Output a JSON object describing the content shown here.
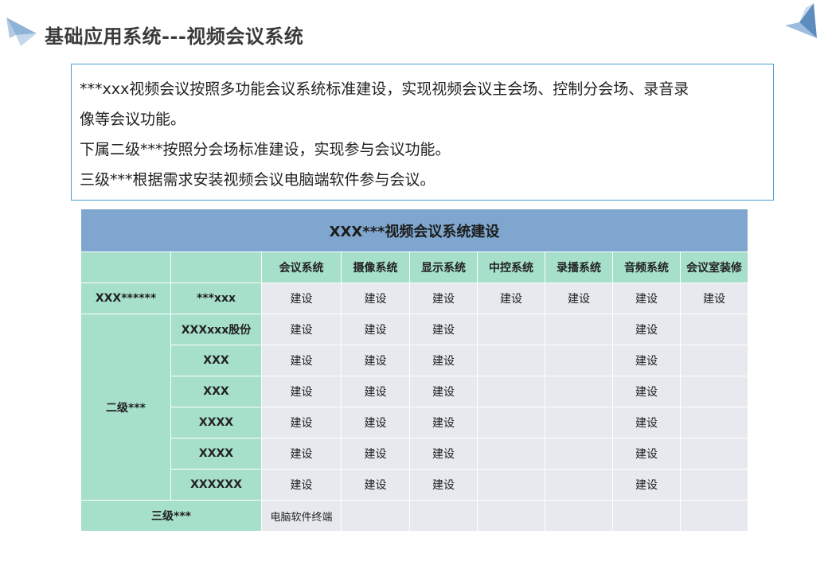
{
  "title": "基础应用系统---视频会议系统",
  "description": [
    "***xxx视频会议按照多功能会议系统标准建设，实现视频会议主会场、控制分会场、录音录",
    "像等会议功能。",
    "下属二级***按照分会场标准建设，实现参与会议功能。",
    "三级***根据需求安装视频会议电脑端软件参与会议。"
  ],
  "table": {
    "title": "XXX***视频会议系统建设",
    "columns": [
      "会议系统",
      "摄像系统",
      "显示系统",
      "中控系统",
      "录播系统",
      "音频系统",
      "会议室装修"
    ],
    "level1": {
      "label": "XXX******",
      "sublabel": "***xxx",
      "cells": [
        "建设",
        "建设",
        "建设",
        "建设",
        "建设",
        "建设",
        "建设"
      ]
    },
    "level2": {
      "label": "二级***",
      "rows": [
        {
          "name": "XXXxxx股份",
          "cells": [
            "建设",
            "建设",
            "建设",
            "",
            "",
            "建设",
            ""
          ]
        },
        {
          "name": "XXX",
          "cells": [
            "建设",
            "建设",
            "建设",
            "",
            "",
            "建设",
            ""
          ]
        },
        {
          "name": "XXX",
          "cells": [
            "建设",
            "建设",
            "建设",
            "",
            "",
            "建设",
            ""
          ]
        },
        {
          "name": "XXXX",
          "cells": [
            "建设",
            "建设",
            "建设",
            "",
            "",
            "建设",
            ""
          ]
        },
        {
          "name": "XXXX",
          "cells": [
            "建设",
            "建设",
            "建设",
            "",
            "",
            "建设",
            ""
          ]
        },
        {
          "name": "XXXXXX",
          "cells": [
            "建设",
            "建设",
            "建设",
            "",
            "",
            "建设",
            ""
          ]
        }
      ]
    },
    "level3": {
      "label": "三级***",
      "cells": [
        "电脑软件终端",
        "",
        "",
        "",
        "",
        "",
        ""
      ]
    }
  },
  "colors": {
    "header_blue": "#7fa6ce",
    "label_green": "#a6dfca",
    "cell_grey": "#e7e9ee",
    "box_border": "#4a9fd2"
  },
  "icons": {
    "left": "paper-plane-icon",
    "right": "paper-plane-icon"
  }
}
